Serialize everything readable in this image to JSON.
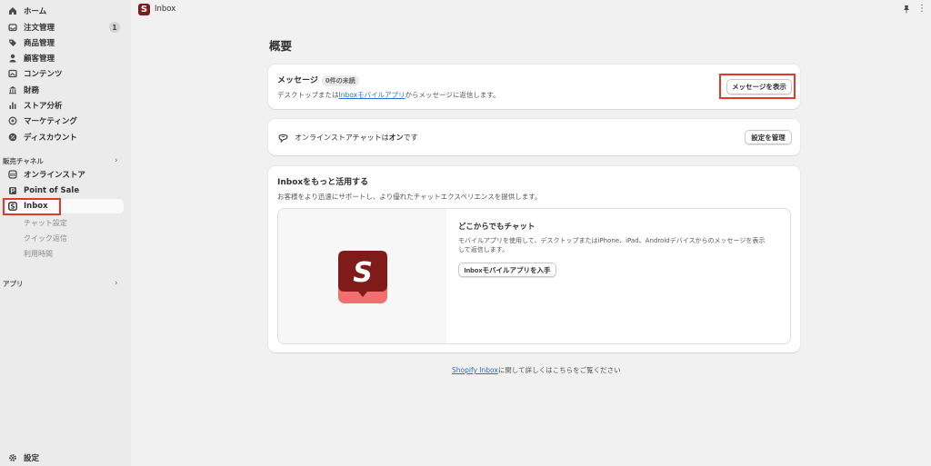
{
  "sidebar": {
    "items": [
      {
        "label": "ホーム",
        "icon": "home-icon"
      },
      {
        "label": "注文管理",
        "icon": "inbox-tray-icon",
        "badge": "1"
      },
      {
        "label": "商品管理",
        "icon": "tag-icon"
      },
      {
        "label": "顧客管理",
        "icon": "person-icon"
      },
      {
        "label": "コンテンツ",
        "icon": "image-icon"
      },
      {
        "label": "財務",
        "icon": "bank-icon"
      },
      {
        "label": "ストア分析",
        "icon": "bar-chart-icon"
      },
      {
        "label": "マーケティング",
        "icon": "target-icon"
      },
      {
        "label": "ディスカウント",
        "icon": "discount-icon"
      }
    ],
    "sales_channels_title": "販売チャネル",
    "channels": [
      {
        "label": "オンラインストア",
        "icon": "store-icon"
      },
      {
        "label": "Point of Sale",
        "icon": "pos-icon"
      },
      {
        "label": "Inbox",
        "icon": "inbox-app-icon"
      }
    ],
    "inbox_sub": [
      "チャット設定",
      "クイック返信",
      "利用時間"
    ],
    "apps_title": "アプリ",
    "settings_label": "設定"
  },
  "topbar": {
    "title": "Inbox",
    "logo_letter": "S"
  },
  "main": {
    "page_title": "概要",
    "messages_card": {
      "title": "メッセージ",
      "badge": "0件の未読",
      "desc_prefix": "デスクトップまたは",
      "desc_link": "Inboxモバイルアプリ",
      "desc_suffix": "からメッセージに返信します。",
      "button": "メッセージを表示"
    },
    "chat_card": {
      "text_prefix": "オンラインストアチャットは",
      "text_bold": "オン",
      "text_suffix": "です",
      "button": "設定を管理"
    },
    "promo_card": {
      "title": "Inboxをもっと活用する",
      "subtitle": "お客様をより迅速にサポートし、より優れたチャットエクスペリエンスを提供します。",
      "box_title": "どこからでもチャット",
      "box_desc_line1": "モバイルアプリを使用して、デスクトップまたはiPhone、iPad、Androidデバイスからのメッセージを表示",
      "box_desc_line2": "して返信します。",
      "box_button": "Inboxモバイルアプリを入手",
      "logo_letter": "S"
    },
    "footer": {
      "link": "Shopify Inbox",
      "suffix": "に関して詳しくはこちらをご覧ください"
    }
  },
  "colors": {
    "highlight": "#e03a28",
    "brand_dark": "#7f1c1a",
    "brand_light": "#f36f6f",
    "link": "#2c6ecb"
  }
}
